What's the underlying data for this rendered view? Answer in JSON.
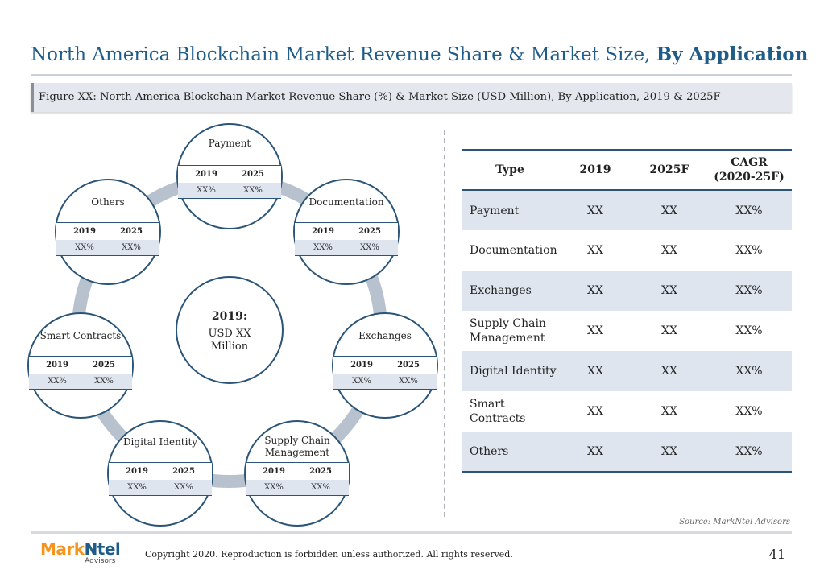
{
  "title": {
    "main": "North America Blockchain Market Revenue Share & Market Size,",
    "bold": "By Application"
  },
  "figure_caption": "Figure XX: North America Blockchain Market Revenue Share (%) & Market Size (USD Million), By Application, 2019 & 2025F",
  "diagram": {
    "center": {
      "year": "2019:",
      "value": "USD XX Million"
    },
    "year_a": "2019",
    "year_b": "2025",
    "segments": [
      {
        "label": "Payment",
        "v2019": "XX%",
        "v2025": "XX%"
      },
      {
        "label": "Documentation",
        "v2019": "XX%",
        "v2025": "XX%"
      },
      {
        "label": "Exchanges",
        "v2019": "XX%",
        "v2025": "XX%"
      },
      {
        "label": "Supply Chain Management",
        "v2019": "XX%",
        "v2025": "XX%"
      },
      {
        "label": "Digital Identity",
        "v2019": "XX%",
        "v2025": "XX%"
      },
      {
        "label": "Smart Contracts",
        "v2019": "XX%",
        "v2025": "XX%"
      },
      {
        "label": "Others",
        "v2019": "XX%",
        "v2025": "XX%"
      }
    ]
  },
  "table": {
    "headers": [
      "Type",
      "2019",
      "2025F",
      "CAGR (2020-25F)"
    ],
    "rows": [
      [
        "Payment",
        "XX",
        "XX",
        "XX%"
      ],
      [
        "Documentation",
        "XX",
        "XX",
        "XX%"
      ],
      [
        "Exchanges",
        "XX",
        "XX",
        "XX%"
      ],
      [
        "Supply Chain Management",
        "XX",
        "XX",
        "XX%"
      ],
      [
        "Digital Identity",
        "XX",
        "XX",
        "XX%"
      ],
      [
        "Smart Contracts",
        "XX",
        "XX",
        "XX%"
      ],
      [
        "Others",
        "XX",
        "XX",
        "XX%"
      ]
    ]
  },
  "source": "Source: MarkNtel Advisors",
  "logo": {
    "mark": "Mark",
    "ntel": "Ntel",
    "sub": "Advisors"
  },
  "copyright": "Copyright 2020. Reproduction is forbidden unless authorized. All rights reserved.",
  "page_number": "41",
  "colors": {
    "accent": "#1f5c87",
    "circle_border": "#2a5478",
    "shade": "#dfe5ee",
    "ring": "#b8c2cf"
  }
}
